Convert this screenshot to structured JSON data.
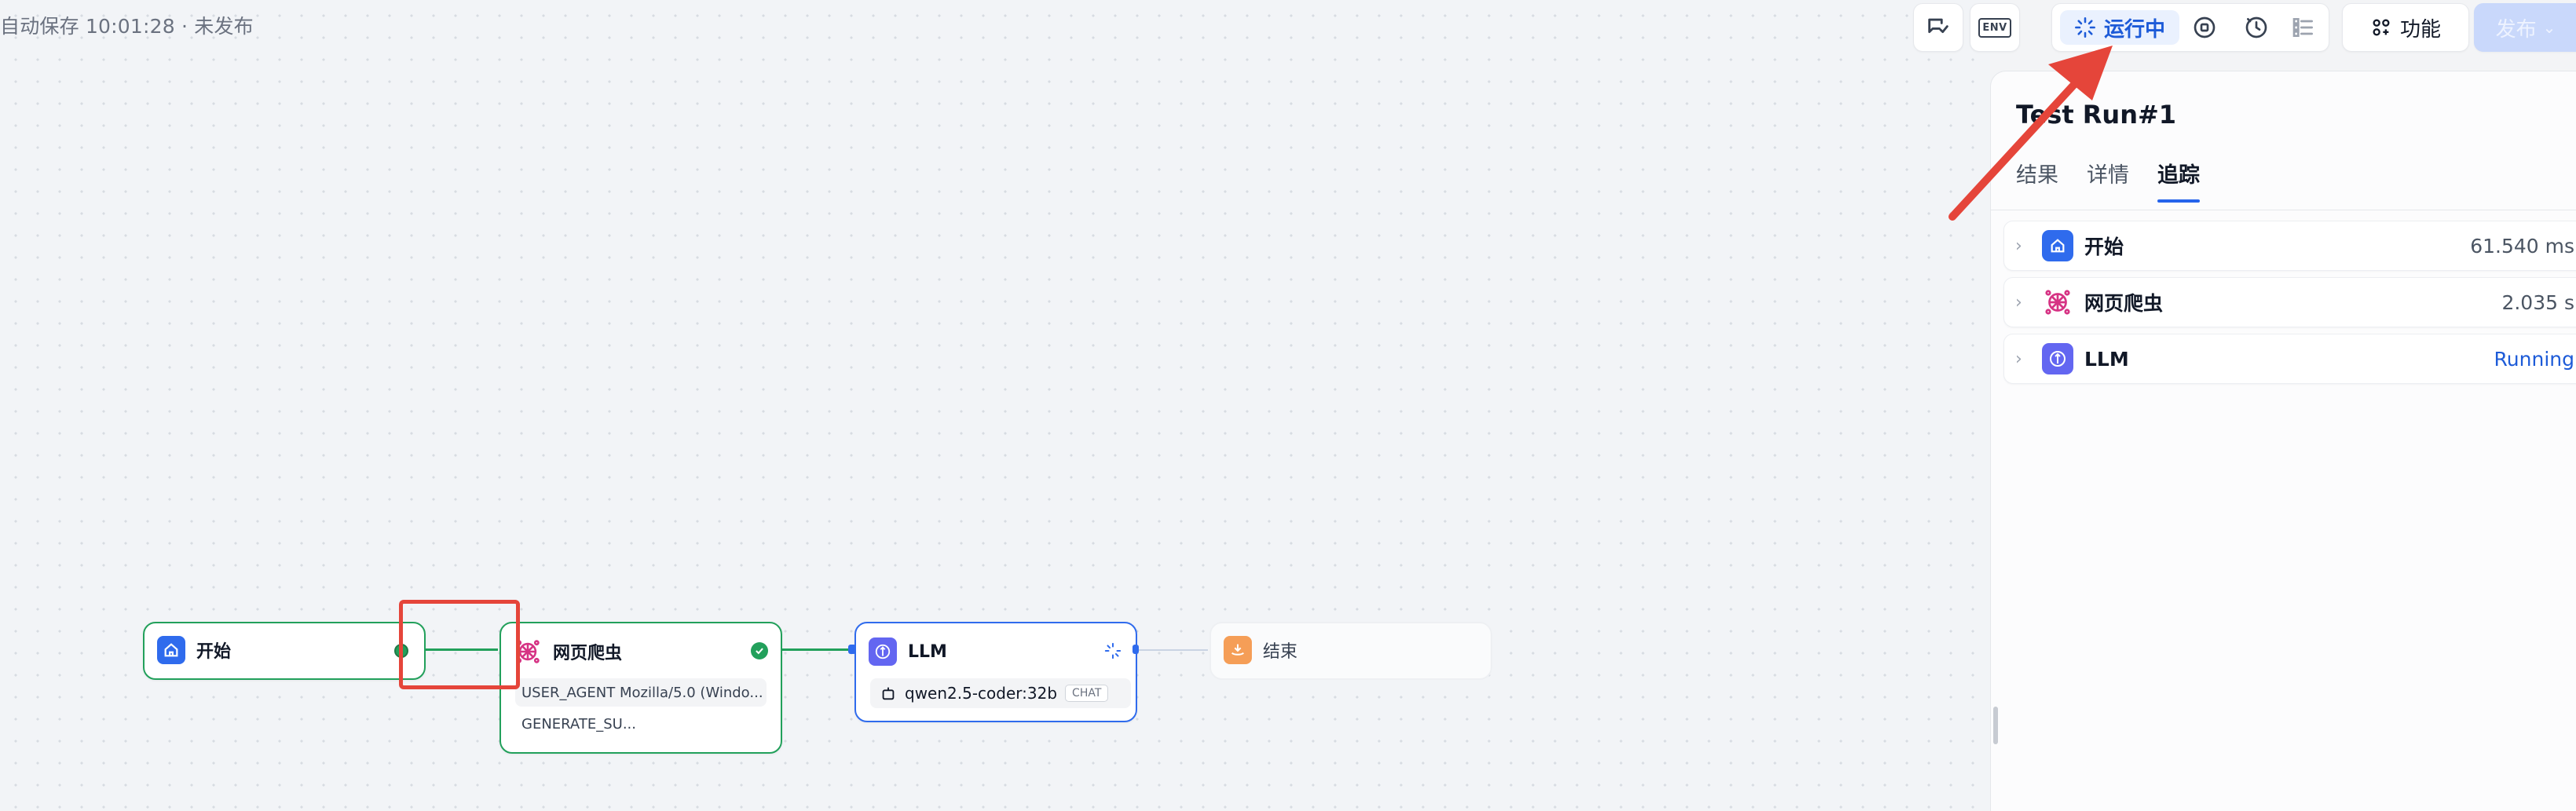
{
  "status_text": "自动保存 10:01:28 · 未发布",
  "toolbar": {
    "run_label": "运行中",
    "env_label": "ENV",
    "feature_label": "功能",
    "publish_label": "发布"
  },
  "panel": {
    "title": "Test Run#1",
    "tabs": [
      {
        "label": "结果",
        "active": false
      },
      {
        "label": "详情",
        "active": false
      },
      {
        "label": "追踪",
        "active": true
      }
    ],
    "trace": [
      {
        "name": "开始",
        "duration": "61.540 ms",
        "icon": "home-icon",
        "color": "#2f6bed"
      },
      {
        "name": "网页爬虫",
        "duration": "2.035 s",
        "icon": "web-crawler-icon",
        "color": "#d63384"
      },
      {
        "name": "LLM",
        "duration": "Running",
        "icon": "llm-icon",
        "color": "#6366f1"
      }
    ]
  },
  "nodes": {
    "start": {
      "title": "开始",
      "icon": "home-icon",
      "status": "success"
    },
    "crawler": {
      "title": "网页爬虫",
      "icon": "web-crawler-icon",
      "status": "success",
      "params": [
        "USER_AGENT Mozilla/5.0 (Windo...",
        "GENERATE_SU..."
      ]
    },
    "llm": {
      "title": "LLM",
      "icon": "llm-icon",
      "status": "running",
      "model": "qwen2.5-coder:32b",
      "model_tag": "CHAT"
    },
    "end": {
      "title": "结束",
      "icon": "end-icon",
      "status": "idle"
    }
  },
  "colors": {
    "accent": "#2563eb",
    "success": "#22a05b",
    "running": "#2f6bed",
    "annotation": "#e5453a"
  }
}
